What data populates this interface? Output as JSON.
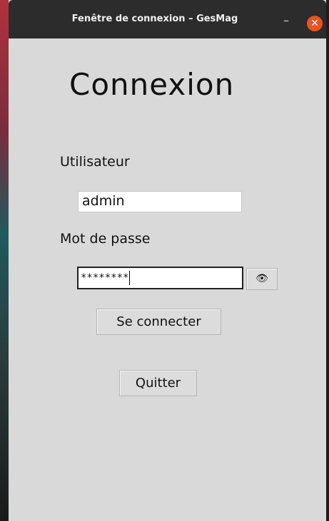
{
  "window": {
    "title": "Fenêtre de connexion – GesMag",
    "minimize_glyph": "–",
    "close_glyph": "✕"
  },
  "form": {
    "heading": "Connexion",
    "username_label": "Utilisateur",
    "username_value": "admin",
    "password_label": "Mot de passe",
    "password_masked": "********",
    "toggle_visibility_icon": "eye-icon",
    "toggle_visibility_glyph": "👁",
    "login_button": "Se connecter",
    "quit_button": "Quitter"
  },
  "colors": {
    "window_bg": "#d9d9d9",
    "titlebar_bg": "#2c2c2c",
    "close_button": "#e95420"
  }
}
